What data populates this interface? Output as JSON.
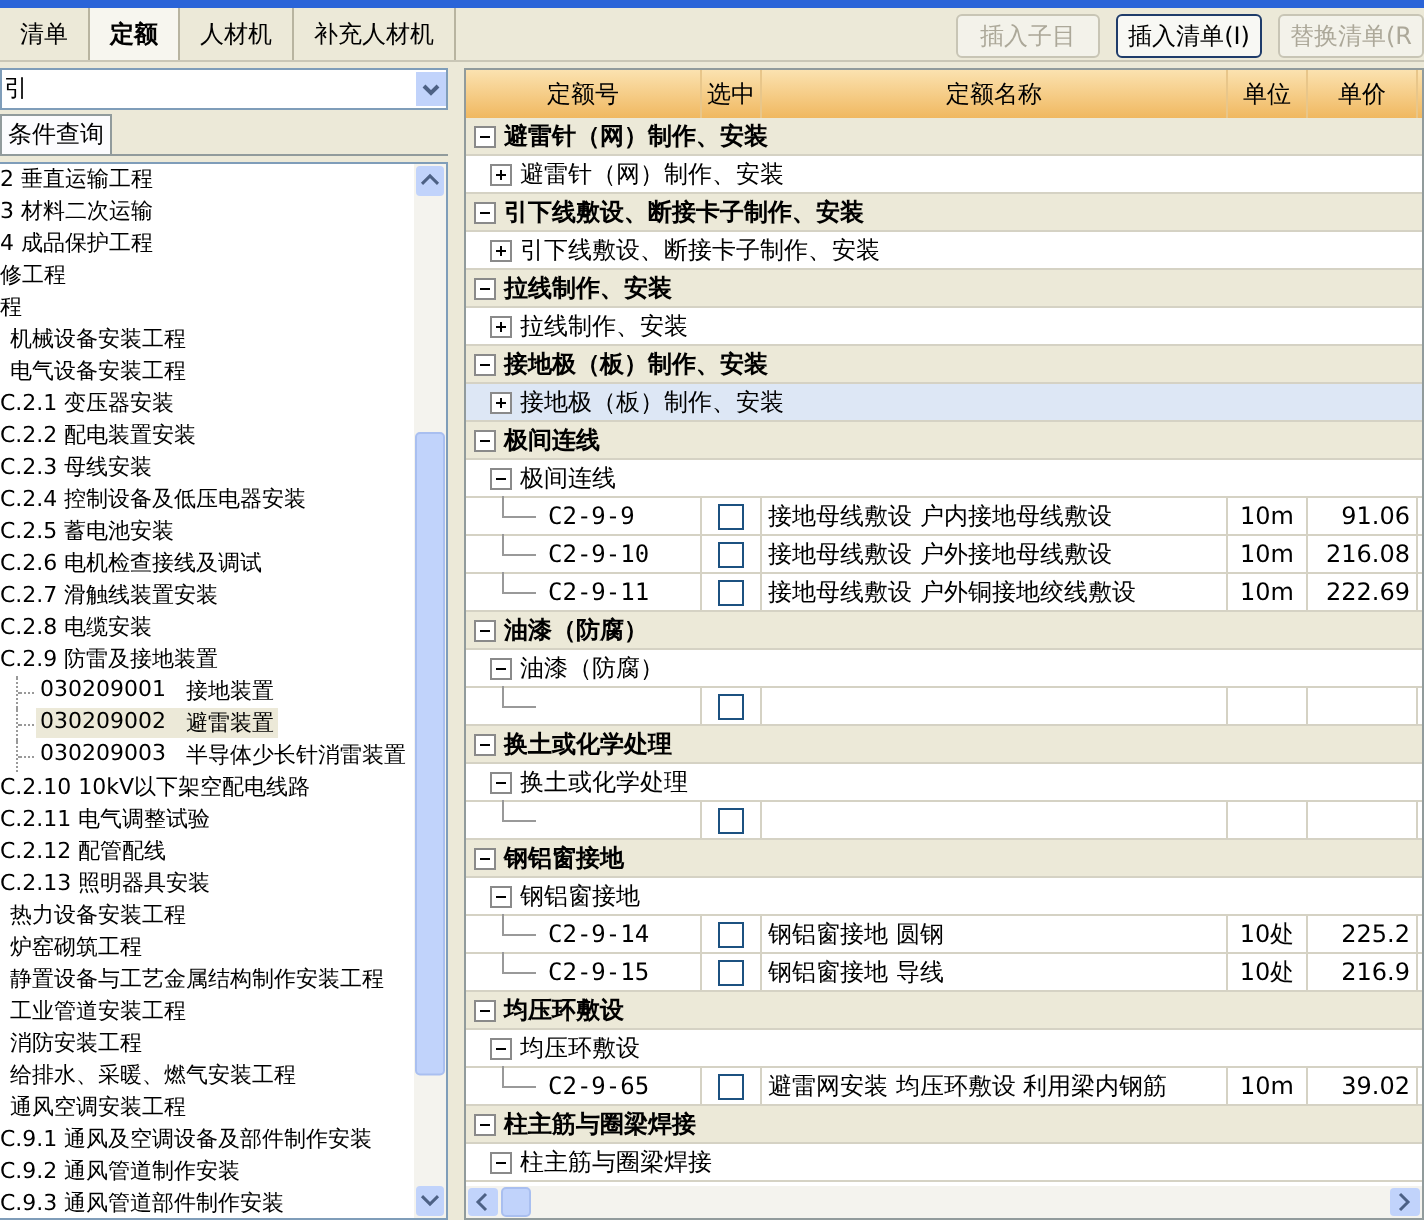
{
  "toolbar": {
    "tabs": [
      {
        "label": "清单",
        "selected": false
      },
      {
        "label": "定额",
        "selected": true
      },
      {
        "label": "人材机",
        "selected": false
      },
      {
        "label": "补充人材机",
        "selected": false
      }
    ],
    "buttons": [
      {
        "label": "插入子目",
        "disabled": true,
        "focused": false
      },
      {
        "label": "插入清单(I)",
        "disabled": false,
        "focused": true
      },
      {
        "label": "替换清单(R",
        "disabled": true,
        "focused": false
      }
    ]
  },
  "left_panel": {
    "dropdown": {
      "value": "引"
    },
    "tabs": [
      {
        "label": "条件查询",
        "selected": true
      }
    ],
    "tree": [
      {
        "label": "2 垂直运输工程",
        "kind": "item"
      },
      {
        "label": "3 材料二次运输",
        "kind": "item"
      },
      {
        "label": "4 成品保护工程",
        "kind": "item"
      },
      {
        "label": "修工程",
        "kind": "item"
      },
      {
        "label": "程",
        "kind": "item"
      },
      {
        "label": "机械设备安装工程",
        "kind": "section"
      },
      {
        "label": "电气设备安装工程",
        "kind": "section"
      },
      {
        "label": "C.2.1 变压器安装",
        "kind": "item"
      },
      {
        "label": "C.2.2 配电装置安装",
        "kind": "item"
      },
      {
        "label": "C.2.3 母线安装",
        "kind": "item"
      },
      {
        "label": "C.2.4 控制设备及低压电器安装",
        "kind": "item"
      },
      {
        "label": "C.2.5 蓄电池安装",
        "kind": "item"
      },
      {
        "label": "C.2.6 电机检查接线及调试",
        "kind": "item"
      },
      {
        "label": "C.2.7 滑触线装置安装",
        "kind": "item"
      },
      {
        "label": "C.2.8 电缆安装",
        "kind": "item"
      },
      {
        "label": "C.2.9 防雷及接地装置",
        "kind": "item",
        "children": [
          {
            "code": "030209001",
            "label": "接地装置",
            "selected": false
          },
          {
            "code": "030209002",
            "label": "避雷装置",
            "selected": true
          },
          {
            "code": "030209003",
            "label": "半导体少长针消雷装置",
            "selected": false
          }
        ]
      },
      {
        "label": "C.2.10 10kV以下架空配电线路",
        "kind": "item"
      },
      {
        "label": "C.2.11 电气调整试验",
        "kind": "item"
      },
      {
        "label": "C.2.12 配管配线",
        "kind": "item"
      },
      {
        "label": "C.2.13 照明器具安装",
        "kind": "item"
      },
      {
        "label": "热力设备安装工程",
        "kind": "section"
      },
      {
        "label": "炉窑砌筑工程",
        "kind": "section"
      },
      {
        "label": "静置设备与工艺金属结构制作安装工程",
        "kind": "section"
      },
      {
        "label": "工业管道安装工程",
        "kind": "section"
      },
      {
        "label": "消防安装工程",
        "kind": "section"
      },
      {
        "label": "给排水、采暖、燃气安装工程",
        "kind": "section"
      },
      {
        "label": "通风空调安装工程",
        "kind": "section"
      },
      {
        "label": "C.9.1 通风及空调设备及部件制作安装",
        "kind": "item"
      },
      {
        "label": "C.9.2 通风管道制作安装",
        "kind": "item"
      },
      {
        "label": "C.9.3 通风管道部件制作安装",
        "kind": "item"
      }
    ]
  },
  "table": {
    "columns": [
      "定额号",
      "选中",
      "定额名称",
      "单位",
      "单价"
    ],
    "groups": [
      {
        "title": "避雷针（网）制作、安装",
        "expanded": true,
        "children": [
          {
            "title": "避雷针（网）制作、安装",
            "expanded": false,
            "selected": false
          }
        ]
      },
      {
        "title": "引下线敷设、断接卡子制作、安装",
        "expanded": true,
        "children": [
          {
            "title": "引下线敷设、断接卡子制作、安装",
            "expanded": false,
            "selected": false
          }
        ]
      },
      {
        "title": "拉线制作、安装",
        "expanded": true,
        "children": [
          {
            "title": "拉线制作、安装",
            "expanded": false,
            "selected": false
          }
        ]
      },
      {
        "title": "接地极（板）制作、安装",
        "expanded": true,
        "children": [
          {
            "title": "接地极（板）制作、安装",
            "expanded": false,
            "selected": true
          }
        ]
      },
      {
        "title": "极间连线",
        "expanded": true,
        "children": [
          {
            "title": "极间连线",
            "expanded": true,
            "selected": false,
            "items": [
              {
                "code": "C2-9-9",
                "checked": false,
                "name": "接地母线敷设 户内接地母线敷设",
                "unit": "10m",
                "price": "91.06"
              },
              {
                "code": "C2-9-10",
                "checked": false,
                "name": "接地母线敷设 户外接地母线敷设",
                "unit": "10m",
                "price": "216.08"
              },
              {
                "code": "C2-9-11",
                "checked": false,
                "name": "接地母线敷设 户外铜接地绞线敷设",
                "unit": "10m",
                "price": "222.69"
              }
            ]
          }
        ]
      },
      {
        "title": "油漆（防腐）",
        "expanded": true,
        "children": [
          {
            "title": "油漆（防腐）",
            "expanded": true,
            "selected": false,
            "items": [
              {
                "checked": false
              }
            ]
          }
        ]
      },
      {
        "title": "换土或化学处理",
        "expanded": true,
        "children": [
          {
            "title": "换土或化学处理",
            "expanded": true,
            "selected": false,
            "items": [
              {
                "checked": false
              }
            ]
          }
        ]
      },
      {
        "title": "钢铝窗接地",
        "expanded": true,
        "children": [
          {
            "title": "钢铝窗接地",
            "expanded": true,
            "selected": false,
            "items": [
              {
                "code": "C2-9-14",
                "checked": false,
                "name": "钢铝窗接地 圆钢",
                "unit": "10处",
                "price": "225.2"
              },
              {
                "code": "C2-9-15",
                "checked": false,
                "name": "钢铝窗接地 导线",
                "unit": "10处",
                "price": "216.9"
              }
            ]
          }
        ]
      },
      {
        "title": "均压环敷设",
        "expanded": true,
        "children": [
          {
            "title": "均压环敷设",
            "expanded": true,
            "selected": false,
            "items": [
              {
                "code": "C2-9-65",
                "checked": false,
                "name": "避雷网安装 均压环敷设 利用梁内钢筋",
                "unit": "10m",
                "price": "39.02"
              }
            ]
          }
        ]
      },
      {
        "title": "柱主筋与圈梁焊接",
        "expanded": true,
        "children": [
          {
            "title": "柱主筋与圈梁焊接",
            "expanded": true,
            "selected": false
          }
        ]
      }
    ]
  }
}
